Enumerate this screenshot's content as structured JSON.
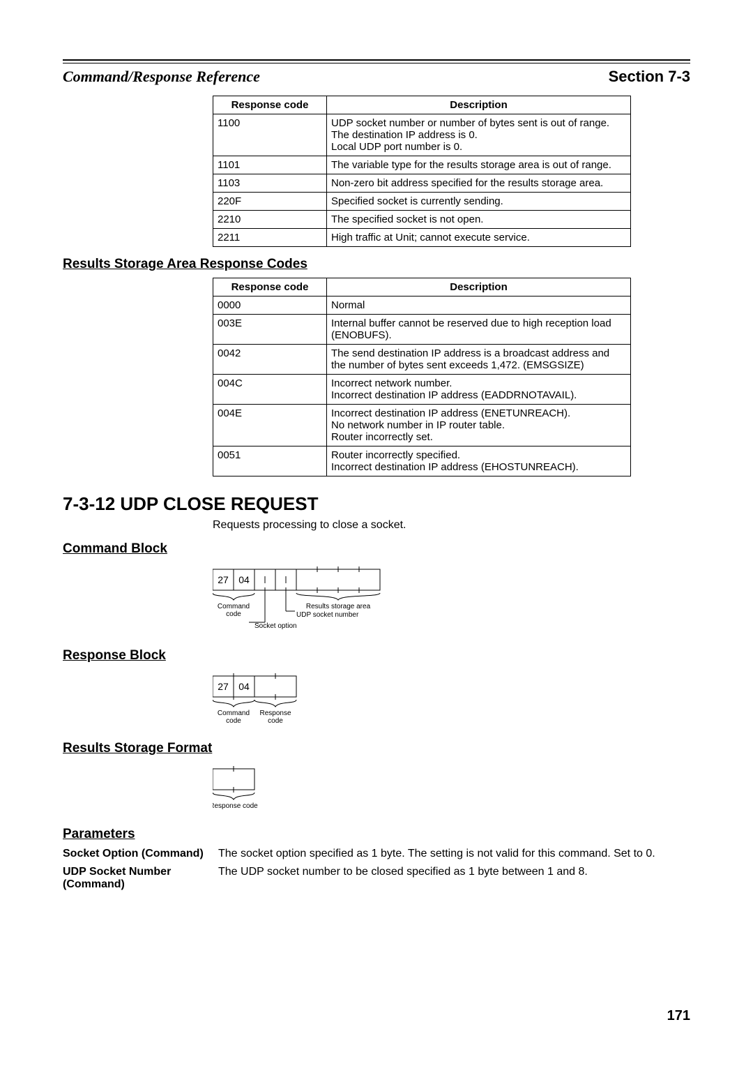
{
  "header": {
    "left": "Command/Response Reference",
    "right_label": "Section",
    "right_num": "7-3"
  },
  "table1": {
    "head_code": "Response code",
    "head_desc": "Description",
    "rows": [
      {
        "c": "1100",
        "d": "UDP socket number or number of bytes sent is out of range.\nThe destination IP address is 0.\nLocal UDP port number is 0."
      },
      {
        "c": "1101",
        "d": "The variable type for the results storage area is out of range."
      },
      {
        "c": "1103",
        "d": "Non-zero bit address specified for the results storage area."
      },
      {
        "c": "220F",
        "d": "Specified socket is currently sending."
      },
      {
        "c": "2210",
        "d": "The specified socket is not open."
      },
      {
        "c": "2211",
        "d": "High traffic at Unit; cannot execute service."
      }
    ]
  },
  "h_results_storage_codes": "Results Storage Area Response Codes",
  "table2": {
    "head_code": "Response code",
    "head_desc": "Description",
    "rows": [
      {
        "c": "0000",
        "d": "Normal"
      },
      {
        "c": "003E",
        "d": "Internal buffer cannot be reserved due to high reception load (ENOBUFS)."
      },
      {
        "c": "0042",
        "d": "The send destination IP address is a broadcast address and the number of bytes sent exceeds 1,472. (EMSGSIZE)"
      },
      {
        "c": "004C",
        "d": "Incorrect network number.\nIncorrect destination IP address (EADDRNOTAVAIL)."
      },
      {
        "c": "004E",
        "d": "Incorrect destination IP address (ENETUNREACH).\nNo network number in IP router table.\nRouter incorrectly set."
      },
      {
        "c": "0051",
        "d": "Router incorrectly specified.\nIncorrect destination IP address (EHOSTUNREACH)."
      }
    ]
  },
  "h_main": "7-3-12  UDP CLOSE REQUEST",
  "intro": "Requests processing to close a socket.",
  "h_command_block": "Command Block",
  "cmd_diag": {
    "b0": "27",
    "b1": "04",
    "l_command_code": "Command",
    "l_command_code2": "code",
    "l_socket_option": "Socket option",
    "l_udp_socket": "UDP socket number",
    "l_results_storage": "Results storage area"
  },
  "h_response_block": "Response Block",
  "resp_diag": {
    "b0": "27",
    "b1": "04",
    "l_command_code": "Command",
    "l_command_code2": "code",
    "l_response_code": "Response",
    "l_response_code2": "code"
  },
  "h_results_format": "Results Storage Format",
  "rsf_diag": {
    "l_response_code": "Response code"
  },
  "h_parameters": "Parameters",
  "params": {
    "socket_option_label": "Socket Option (Command)",
    "socket_option_text": "The socket option specified as 1 byte. The setting is not valid for this command. Set to 0.",
    "udp_socket_label": "UDP Socket Number (Command)",
    "udp_socket_text": "The UDP socket number to be closed specified as 1 byte between 1 and 8."
  },
  "page_number": "171"
}
